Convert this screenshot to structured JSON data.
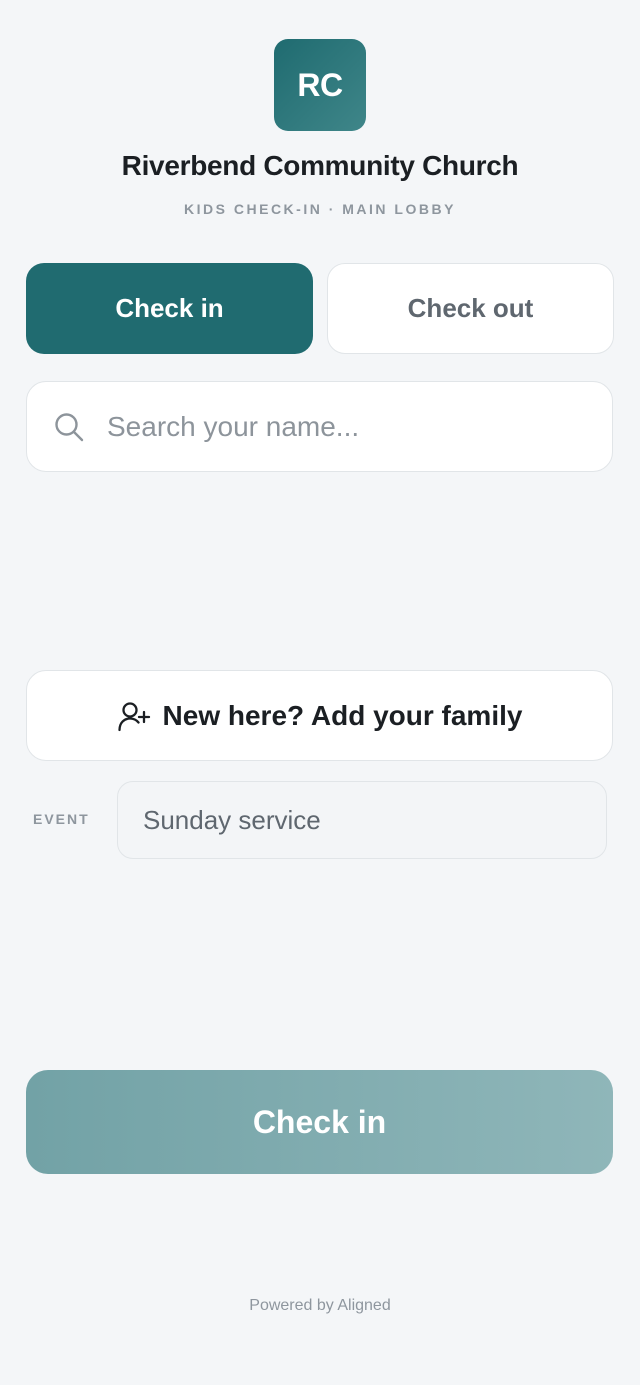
{
  "header": {
    "logo_initials": "RC",
    "church_name": "Riverbend Community Church",
    "subtitle": "KIDS CHECK-IN · MAIN LOBBY"
  },
  "mode_toggle": {
    "check_in_label": "Check in",
    "check_out_label": "Check out",
    "active": "check_in"
  },
  "search": {
    "placeholder": "Search your name...",
    "value": ""
  },
  "add_family": {
    "label": "New here? Add your family"
  },
  "event": {
    "label": "EVENT",
    "selected": "Sunday service"
  },
  "submit": {
    "label": "Check in"
  },
  "footer": {
    "text": "Powered by Aligned"
  },
  "colors": {
    "primary": "#206b70",
    "primary_disabled": "#80abaf",
    "background": "#f4f6f8",
    "text": "#1b1f23",
    "muted": "#8e969e"
  },
  "icons": {
    "search": "search-icon",
    "add_family": "user-plus-icon"
  }
}
